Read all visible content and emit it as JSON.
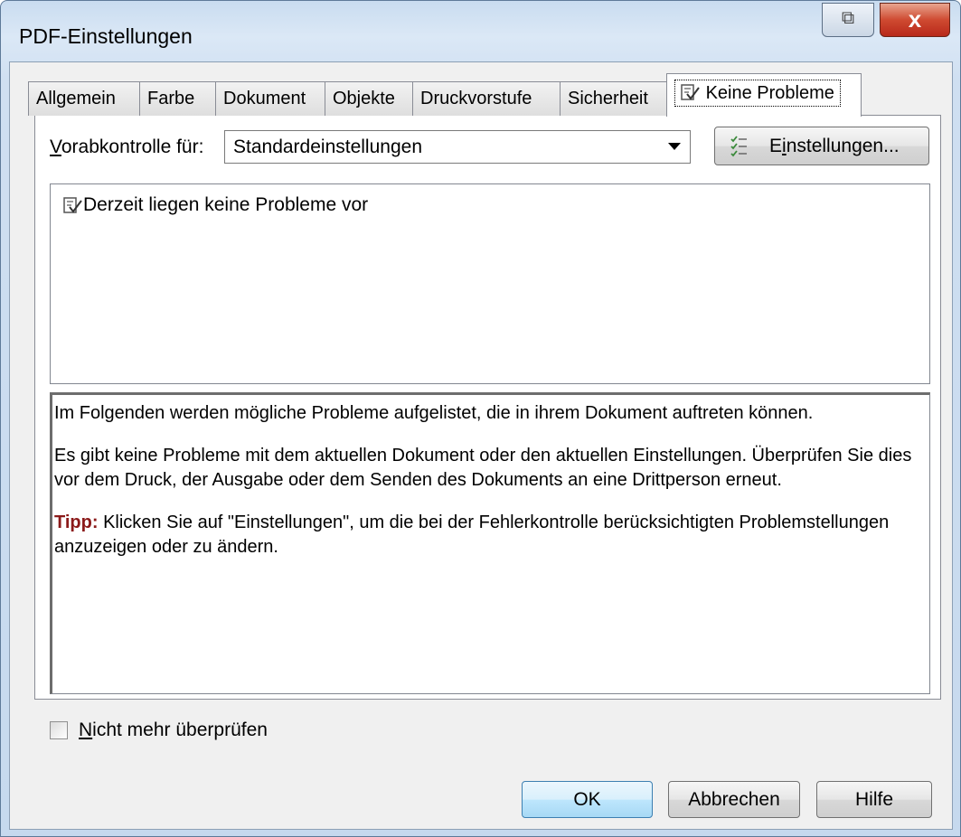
{
  "window": {
    "title": "PDF-Einstellungen",
    "restore_icon": "restore-window-icon",
    "close_label": "x"
  },
  "tabs": [
    {
      "label": "Allgemein"
    },
    {
      "label": "Farbe"
    },
    {
      "label": "Dokument"
    },
    {
      "label": "Objekte"
    },
    {
      "label": "Druckvorstufe"
    },
    {
      "label": "Sicherheit"
    },
    {
      "label": "Keine Probleme",
      "icon": "checklist-check-icon",
      "active": true
    }
  ],
  "preflight": {
    "label_first": "V",
    "label_rest": "orabkontrolle für:",
    "selected": "Standardeinstellungen",
    "settings_button_pre": "E",
    "settings_button_u": "i",
    "settings_button_post": "nstellungen..."
  },
  "issues": {
    "items": [
      {
        "label": "Derzeit liegen keine Probleme vor",
        "icon": "checklist-check-icon"
      }
    ]
  },
  "description": {
    "line1": "Im Folgenden werden mögliche Probleme aufgelistet, die in ihrem Dokument auftreten können.",
    "line2": "Es gibt keine Probleme mit dem aktuellen Dokument oder den aktuellen Einstellungen. Überprüfen Sie dies vor dem Druck, der Ausgabe oder dem Senden des Dokuments an eine Drittperson erneut.",
    "tip_label": "Tipp:",
    "tip_text": " Klicken Sie auf \"Einstellungen\", um die bei der Fehlerkontrolle berücksichtigten Problemstellungen anzuzeigen oder zu ändern."
  },
  "checkbox": {
    "label_first": "N",
    "label_rest": "icht mehr überprüfen",
    "checked": false
  },
  "buttons": {
    "ok": "OK",
    "cancel": "Abbrechen",
    "help": "Hilfe"
  },
  "colors": {
    "tip": "#8b1a1a",
    "close_button": "#c7432b",
    "window_frame": "#c6d9ee"
  }
}
